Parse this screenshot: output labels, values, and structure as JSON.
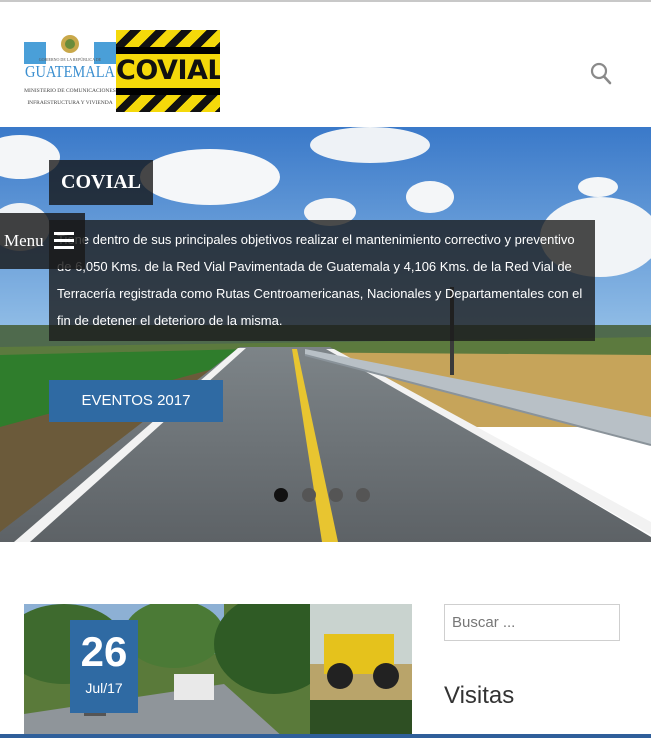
{
  "header": {
    "logo_government_lines": [
      "GOBIERNO DE LA REPÚBLICA DE",
      "GUATEMALA",
      "MINISTERIO DE COMUNICACIONES",
      "INFRAESTRUCTURA Y VIVIENDA"
    ],
    "logo_brand": "COVIAL",
    "search_icon": "search-icon"
  },
  "hero": {
    "title": "COVIAL",
    "description": "Tiene dentro de sus principales objetivos realizar el mantenimiento correctivo y preventivo de 6,050 Kms. de la Red Vial Pavimentada de Guatemala y 4,106 Kms. de la Red Vial de Terracería registrada como Rutas Centroamericanas, Nacionales y Departamentales con el fin de detener el deterioro de la misma.",
    "menu_label": "Menu",
    "cta_label": "EVENTOS 2017",
    "slide_count": 4,
    "active_slide": 1
  },
  "post": {
    "date_day": "26",
    "date_month": "Jul/17"
  },
  "sidebar": {
    "search_placeholder": "Buscar ...",
    "widget_title": "Visitas"
  },
  "colors": {
    "accent_blue": "#2f6aa3",
    "covial_yellow": "#f5d90a",
    "overlay_dark": "#191919"
  }
}
